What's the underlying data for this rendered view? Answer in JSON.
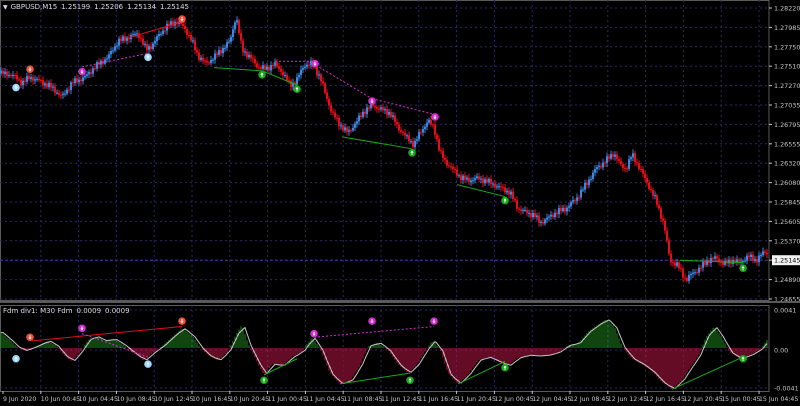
{
  "header": {
    "symbol": "GBPUSD,M15",
    "ohlc": [
      "1.25199",
      "1.25206",
      "1.25134",
      "1.25145"
    ]
  },
  "indicator_header": {
    "name": "Fdm div1: M30 Fdm",
    "values": [
      "0.0009",
      "0.0009"
    ]
  },
  "colors": {
    "bull": "#3d85e0",
    "bear": "#e0101a",
    "grid": "#2a2a66",
    "axis": "#c8c8c8",
    "bull_div": "#d22cd2",
    "bear_div": "#1aa81a",
    "hist_pos": "#1f8a1f",
    "hist_neg": "#c8184a",
    "signal": "#c8c8c8",
    "current_line": "#3a3aa0"
  },
  "chart_data": [
    {
      "type": "candlestick",
      "title": "GBPUSD,M15",
      "ylim": [
        1.2455,
        1.2832
      ],
      "y_ticks": [
        "1.28220",
        "1.27985",
        "1.27750",
        "1.27510",
        "1.27270",
        "1.27035",
        "1.26795",
        "1.26555",
        "1.26320",
        "1.26080",
        "1.25845",
        "1.25605",
        "1.25370",
        "1.25145",
        "1.24890",
        "1.24655"
      ],
      "current_price": "1.25145",
      "x_ticks": [
        "9 Jun 2020",
        "10 Jun 00:45",
        "10 Jun 04:45",
        "10 Jun 08:45",
        "10 Jun 12:45",
        "10 Jun 16:45",
        "10 Jun 20:45",
        "11 Jun 00:45",
        "11 Jun 04:45",
        "11 Jun 08:45",
        "11 Jun 12:45",
        "11 Jun 16:45",
        "11 Jun 20:45",
        "12 Jun 00:45",
        "12 Jun 04:45",
        "12 Jun 08:45",
        "12 Jun 12:45",
        "12 Jun 16:45",
        "12 Jun 20:45",
        "15 Jun 00:45",
        "15 Jun 04:45"
      ],
      "close_path": [
        [
          0,
          1.274
        ],
        [
          12,
          1.2738
        ],
        [
          22,
          1.2728
        ],
        [
          30,
          1.2735
        ],
        [
          40,
          1.273
        ],
        [
          52,
          1.2722
        ],
        [
          62,
          1.271
        ],
        [
          72,
          1.2728
        ],
        [
          85,
          1.2735
        ],
        [
          95,
          1.2748
        ],
        [
          108,
          1.276
        ],
        [
          118,
          1.278
        ],
        [
          128,
          1.2785
        ],
        [
          138,
          1.279
        ],
        [
          146,
          1.277
        ],
        [
          152,
          1.2775
        ],
        [
          160,
          1.279
        ],
        [
          168,
          1.28
        ],
        [
          176,
          1.2805
        ],
        [
          184,
          1.2798
        ],
        [
          192,
          1.278
        ],
        [
          198,
          1.2762
        ],
        [
          206,
          1.2752
        ],
        [
          214,
          1.276
        ],
        [
          222,
          1.277
        ],
        [
          230,
          1.278
        ],
        [
          236,
          1.2812
        ],
        [
          242,
          1.277
        ],
        [
          250,
          1.276
        ],
        [
          258,
          1.2748
        ],
        [
          266,
          1.2745
        ],
        [
          274,
          1.2752
        ],
        [
          282,
          1.2742
        ],
        [
          290,
          1.2725
        ],
        [
          296,
          1.273
        ],
        [
          304,
          1.275
        ],
        [
          312,
          1.2752
        ],
        [
          320,
          1.2735
        ],
        [
          326,
          1.2712
        ],
        [
          332,
          1.269
        ],
        [
          340,
          1.2675
        ],
        [
          348,
          1.2665
        ],
        [
          356,
          1.2678
        ],
        [
          364,
          1.2692
        ],
        [
          372,
          1.27
        ],
        [
          380,
          1.2695
        ],
        [
          390,
          1.269
        ],
        [
          398,
          1.2672
        ],
        [
          406,
          1.266
        ],
        [
          414,
          1.265
        ],
        [
          420,
          1.2665
        ],
        [
          428,
          1.268
        ],
        [
          434,
          1.2672
        ],
        [
          440,
          1.264
        ],
        [
          446,
          1.2628
        ],
        [
          452,
          1.262
        ],
        [
          460,
          1.261
        ],
        [
          468,
          1.2605
        ],
        [
          476,
          1.2608
        ],
        [
          486,
          1.2605
        ],
        [
          494,
          1.26
        ],
        [
          502,
          1.2595
        ],
        [
          510,
          1.259
        ],
        [
          518,
          1.257
        ],
        [
          526,
          1.2565
        ],
        [
          534,
          1.2562
        ],
        [
          540,
          1.2552
        ],
        [
          548,
          1.2558
        ],
        [
          556,
          1.2565
        ],
        [
          566,
          1.257
        ],
        [
          576,
          1.2582
        ],
        [
          586,
          1.26
        ],
        [
          596,
          1.262
        ],
        [
          606,
          1.263
        ],
        [
          614,
          1.264
        ],
        [
          620,
          1.2625
        ],
        [
          626,
          1.262
        ],
        [
          632,
          1.2638
        ],
        [
          640,
          1.262
        ],
        [
          648,
          1.26
        ],
        [
          656,
          1.258
        ],
        [
          664,
          1.255
        ],
        [
          670,
          1.2505
        ],
        [
          678,
          1.2498
        ],
        [
          686,
          1.248
        ],
        [
          692,
          1.2488
        ],
        [
          700,
          1.2495
        ],
        [
          708,
          1.2505
        ],
        [
          716,
          1.2508
        ],
        [
          724,
          1.25
        ],
        [
          732,
          1.2505
        ],
        [
          740,
          1.2502
        ],
        [
          748,
          1.251
        ],
        [
          756,
          1.2505
        ],
        [
          764,
          1.2515
        ],
        [
          767,
          1.25145
        ]
      ],
      "annotations": [
        {
          "x": 16,
          "y": 1.2722,
          "icon": "up-arrow-icon",
          "kind": "bull"
        },
        {
          "x": 30,
          "y": 1.2745,
          "icon": "down-arrow-icon",
          "kind": "bear"
        },
        {
          "x": 82,
          "y": 1.2742,
          "icon": "down-arrow-icon",
          "kind": "bull_div"
        },
        {
          "x": 148,
          "y": 1.276,
          "icon": "up-arrow-icon",
          "kind": "bull"
        },
        {
          "x": 182,
          "y": 1.2808,
          "icon": "down-arrow-icon",
          "kind": "bear"
        },
        {
          "x": 262,
          "y": 1.2738,
          "icon": "up-arrow-icon",
          "kind": "bear_div"
        },
        {
          "x": 297,
          "y": 1.272,
          "icon": "up-arrow-icon",
          "kind": "bear_div"
        },
        {
          "x": 315,
          "y": 1.2752,
          "icon": "down-arrow-icon",
          "kind": "bull_div"
        },
        {
          "x": 372,
          "y": 1.2705,
          "icon": "down-arrow-icon",
          "kind": "bull_div"
        },
        {
          "x": 412,
          "y": 1.264,
          "icon": "up-arrow-icon",
          "kind": "bear_div"
        },
        {
          "x": 435,
          "y": 1.2685,
          "icon": "down-arrow-icon",
          "kind": "bull_div"
        },
        {
          "x": 505,
          "y": 1.258,
          "icon": "up-arrow-icon",
          "kind": "bear_div"
        },
        {
          "x": 743,
          "y": 1.2495,
          "icon": "up-arrow-icon",
          "kind": "bear_div"
        }
      ],
      "divergence_lines": [
        {
          "kind": "bear",
          "from": [
            130,
            1.2785
          ],
          "to": [
            183,
            1.2805
          ]
        },
        {
          "kind": "bull",
          "from": [
            82,
            1.2748
          ],
          "to": [
            148,
            1.2765
          ]
        },
        {
          "kind": "green",
          "from": [
            214,
            1.2747
          ],
          "to": [
            262,
            1.2743
          ]
        },
        {
          "kind": "green",
          "from": [
            262,
            1.2743
          ],
          "to": [
            297,
            1.2725
          ]
        },
        {
          "kind": "bull",
          "from": [
            275,
            1.2755
          ],
          "to": [
            316,
            1.2755
          ]
        },
        {
          "kind": "bull",
          "from": [
            316,
            1.275
          ],
          "to": [
            372,
            1.2708
          ]
        },
        {
          "kind": "bull",
          "from": [
            372,
            1.2708
          ],
          "to": [
            435,
            1.2688
          ]
        },
        {
          "kind": "green",
          "from": [
            342,
            1.266
          ],
          "to": [
            412,
            1.2645
          ]
        },
        {
          "kind": "green",
          "from": [
            457,
            1.26
          ],
          "to": [
            505,
            1.2585
          ]
        },
        {
          "kind": "green",
          "from": [
            680,
            1.2505
          ],
          "to": [
            743,
            1.2502
          ]
        }
      ]
    },
    {
      "type": "histogram",
      "title": "Fdm div1: M30 Fdm 0.0009 0.0009",
      "ylim": [
        -0.0048,
        0.0048
      ],
      "y_ticks": [
        "0.0041",
        "0.00",
        "-0.0041"
      ],
      "hist_path": [
        [
          0,
          0.0018
        ],
        [
          10,
          0.0009
        ],
        [
          16,
          0.0002
        ],
        [
          24,
          -0.0003
        ],
        [
          32,
          0.0
        ],
        [
          40,
          0.0004
        ],
        [
          48,
          0.0008
        ],
        [
          56,
          0.0003
        ],
        [
          64,
          -0.0008
        ],
        [
          72,
          -0.0015
        ],
        [
          80,
          -0.0005
        ],
        [
          88,
          0.0009
        ],
        [
          96,
          0.0013
        ],
        [
          104,
          0.0008
        ],
        [
          114,
          0.001
        ],
        [
          124,
          0.0003
        ],
        [
          134,
          -0.0006
        ],
        [
          144,
          -0.0014
        ],
        [
          152,
          -0.0006
        ],
        [
          162,
          0.0002
        ],
        [
          172,
          0.0012
        ],
        [
          182,
          0.0022
        ],
        [
          192,
          0.0014
        ],
        [
          200,
          0.0001
        ],
        [
          208,
          -0.0008
        ],
        [
          218,
          -0.0014
        ],
        [
          228,
          -0.0004
        ],
        [
          236,
          0.0015
        ],
        [
          242,
          0.0026
        ],
        [
          248,
          0.0005
        ],
        [
          256,
          -0.0013
        ],
        [
          264,
          -0.003
        ],
        [
          272,
          -0.0018
        ],
        [
          282,
          -0.002
        ],
        [
          292,
          -0.001
        ],
        [
          302,
          -0.0004
        ],
        [
          312,
          0.0012
        ],
        [
          320,
          0.0
        ],
        [
          330,
          -0.0028
        ],
        [
          340,
          -0.004
        ],
        [
          350,
          -0.0037
        ],
        [
          360,
          -0.002
        ],
        [
          368,
          0.0002
        ],
        [
          378,
          0.0006
        ],
        [
          388,
          -0.0002
        ],
        [
          398,
          -0.0018
        ],
        [
          408,
          -0.0028
        ],
        [
          416,
          -0.002
        ],
        [
          424,
          -0.0006
        ],
        [
          432,
          0.0008
        ],
        [
          440,
          0.0
        ],
        [
          448,
          -0.0028
        ],
        [
          458,
          -0.004
        ],
        [
          468,
          -0.003
        ],
        [
          478,
          -0.0014
        ],
        [
          488,
          -0.001
        ],
        [
          498,
          -0.0015
        ],
        [
          508,
          -0.002
        ],
        [
          518,
          -0.0011
        ],
        [
          528,
          -0.0008
        ],
        [
          538,
          -0.0009
        ],
        [
          548,
          -0.0008
        ],
        [
          558,
          -0.0005
        ],
        [
          568,
          0.0003
        ],
        [
          578,
          0.0005
        ],
        [
          588,
          0.0018
        ],
        [
          598,
          0.0026
        ],
        [
          606,
          0.0032
        ],
        [
          614,
          0.0025
        ],
        [
          622,
          0.0002
        ],
        [
          632,
          -0.0012
        ],
        [
          642,
          -0.0018
        ],
        [
          652,
          -0.0026
        ],
        [
          662,
          -0.0038
        ],
        [
          672,
          -0.0046
        ],
        [
          682,
          -0.0036
        ],
        [
          690,
          -0.0022
        ],
        [
          698,
          -0.001
        ],
        [
          706,
          0.0012
        ],
        [
          714,
          0.0024
        ],
        [
          720,
          0.0015
        ],
        [
          730,
          -0.0005
        ],
        [
          740,
          -0.0012
        ],
        [
          750,
          -0.0008
        ],
        [
          760,
          -0.0002
        ],
        [
          767,
          0.0009
        ]
      ],
      "annotations": [
        {
          "x": 16,
          "y": -0.0012,
          "icon": "up-arrow-icon",
          "kind": "bull"
        },
        {
          "x": 30,
          "y": 0.0012,
          "icon": "down-arrow-icon",
          "kind": "bear"
        },
        {
          "x": 82,
          "y": 0.0022,
          "icon": "down-arrow-icon",
          "kind": "bull_div"
        },
        {
          "x": 148,
          "y": -0.0018,
          "icon": "up-arrow-icon",
          "kind": "bull"
        },
        {
          "x": 182,
          "y": 0.003,
          "icon": "down-arrow-icon",
          "kind": "bear"
        },
        {
          "x": 264,
          "y": -0.0036,
          "icon": "up-arrow-icon",
          "kind": "bear_div"
        },
        {
          "x": 314,
          "y": 0.0016,
          "icon": "down-arrow-icon",
          "kind": "bull_div"
        },
        {
          "x": 372,
          "y": 0.003,
          "icon": "down-arrow-icon",
          "kind": "bull_div"
        },
        {
          "x": 410,
          "y": -0.0036,
          "icon": "up-arrow-icon",
          "kind": "bear_div"
        },
        {
          "x": 434,
          "y": 0.003,
          "icon": "down-arrow-icon",
          "kind": "bull_div"
        },
        {
          "x": 505,
          "y": -0.0022,
          "icon": "up-arrow-icon",
          "kind": "bear_div"
        },
        {
          "x": 743,
          "y": -0.0012,
          "icon": "up-arrow-icon",
          "kind": "bear_div"
        }
      ],
      "divergence_lines": [
        {
          "kind": "bear",
          "from": [
            32,
            0.0008
          ],
          "to": [
            182,
            0.0024
          ]
        },
        {
          "kind": "bull",
          "from": [
            82,
            0.0016
          ],
          "to": [
            148,
            -0.001
          ]
        },
        {
          "kind": "green",
          "from": [
            264,
            -0.003
          ],
          "to": [
            297,
            -0.0012
          ]
        },
        {
          "kind": "bull",
          "from": [
            314,
            0.0012
          ],
          "to": [
            434,
            0.0024
          ]
        },
        {
          "kind": "green",
          "from": [
            340,
            -0.004
          ],
          "to": [
            410,
            -0.0028
          ]
        },
        {
          "kind": "green",
          "from": [
            458,
            -0.004
          ],
          "to": [
            505,
            -0.0015
          ]
        },
        {
          "kind": "green",
          "from": [
            672,
            -0.0046
          ],
          "to": [
            743,
            -0.001
          ]
        }
      ]
    }
  ]
}
